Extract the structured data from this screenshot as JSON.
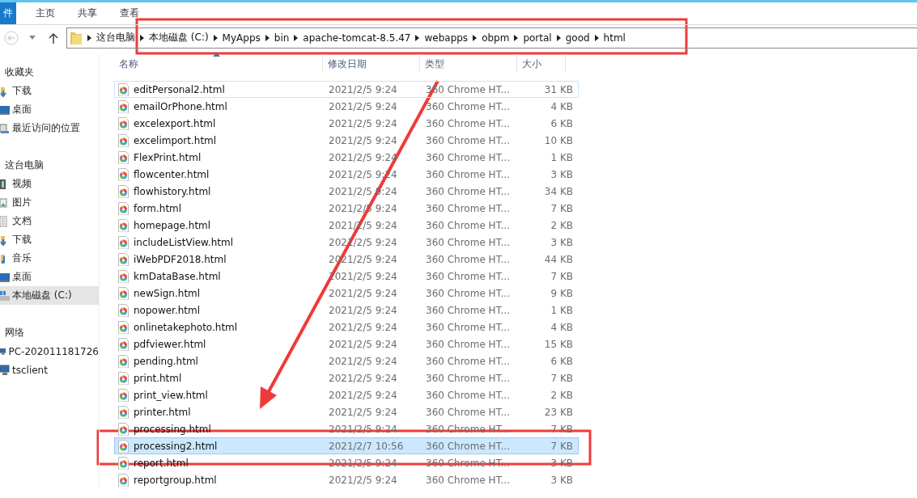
{
  "ribbon": {
    "tabs": [
      {
        "label": "件",
        "kind": "file"
      },
      {
        "label": "主页",
        "kind": "tab"
      },
      {
        "label": "共享",
        "kind": "tab"
      },
      {
        "label": "查看",
        "kind": "tab"
      }
    ]
  },
  "address": {
    "crumbs": [
      "这台电脑",
      "本地磁盘 (C:)",
      "MyApps",
      "bin",
      "apache-tomcat-8.5.47",
      "webapps",
      "obpm",
      "portal",
      "good",
      "html"
    ]
  },
  "sidebar": {
    "items": [
      {
        "label": "收藏夹",
        "kind": "heading",
        "selected": false
      },
      {
        "label": "下载",
        "kind": "download",
        "selected": false
      },
      {
        "label": "桌面",
        "kind": "desktop",
        "selected": false
      },
      {
        "label": "最近访问的位置",
        "kind": "recent",
        "selected": false
      },
      {
        "label": "这台电脑",
        "kind": "heading",
        "selected": false
      },
      {
        "label": "视频",
        "kind": "video",
        "selected": false
      },
      {
        "label": "图片",
        "kind": "pictures",
        "selected": false
      },
      {
        "label": "文档",
        "kind": "documents",
        "selected": false
      },
      {
        "label": "下载",
        "kind": "download",
        "selected": false
      },
      {
        "label": "音乐",
        "kind": "music",
        "selected": false
      },
      {
        "label": "桌面",
        "kind": "desktop",
        "selected": false
      },
      {
        "label": "本地磁盘 (C:)",
        "kind": "drive",
        "selected": true
      },
      {
        "label": "网络",
        "kind": "heading",
        "selected": false
      },
      {
        "label": "PC-202011181726",
        "kind": "computer",
        "selected": false
      },
      {
        "label": "tsclient",
        "kind": "computer",
        "selected": false
      }
    ]
  },
  "table": {
    "columns": [
      "名称",
      "修改日期",
      "类型",
      "大小"
    ],
    "rows": [
      {
        "name": "editPersonal2.html",
        "modified": "2021/2/5 9:24",
        "type": "360 Chrome HT...",
        "size": "31 KB",
        "selected": false,
        "hover": true
      },
      {
        "name": "emailOrPhone.html",
        "modified": "2021/2/5 9:24",
        "type": "360 Chrome HT...",
        "size": "4 KB",
        "selected": false,
        "hover": false
      },
      {
        "name": "excelexport.html",
        "modified": "2021/2/5 9:24",
        "type": "360 Chrome HT...",
        "size": "6 KB",
        "selected": false,
        "hover": false
      },
      {
        "name": "excelimport.html",
        "modified": "2021/2/5 9:24",
        "type": "360 Chrome HT...",
        "size": "10 KB",
        "selected": false,
        "hover": false
      },
      {
        "name": "FlexPrint.html",
        "modified": "2021/2/5 9:24",
        "type": "360 Chrome HT...",
        "size": "1 KB",
        "selected": false,
        "hover": false
      },
      {
        "name": "flowcenter.html",
        "modified": "2021/2/5 9:24",
        "type": "360 Chrome HT...",
        "size": "3 KB",
        "selected": false,
        "hover": false
      },
      {
        "name": "flowhistory.html",
        "modified": "2021/2/5 9:24",
        "type": "360 Chrome HT...",
        "size": "34 KB",
        "selected": false,
        "hover": false
      },
      {
        "name": "form.html",
        "modified": "2021/2/5 9:24",
        "type": "360 Chrome HT...",
        "size": "7 KB",
        "selected": false,
        "hover": false
      },
      {
        "name": "homepage.html",
        "modified": "2021/2/5 9:24",
        "type": "360 Chrome HT...",
        "size": "2 KB",
        "selected": false,
        "hover": false
      },
      {
        "name": "includeListView.html",
        "modified": "2021/2/5 9:24",
        "type": "360 Chrome HT...",
        "size": "3 KB",
        "selected": false,
        "hover": false
      },
      {
        "name": "iWebPDF2018.html",
        "modified": "2021/2/5 9:24",
        "type": "360 Chrome HT...",
        "size": "44 KB",
        "selected": false,
        "hover": false
      },
      {
        "name": "kmDataBase.html",
        "modified": "2021/2/5 9:24",
        "type": "360 Chrome HT...",
        "size": "7 KB",
        "selected": false,
        "hover": false
      },
      {
        "name": "newSign.html",
        "modified": "2021/2/5 9:24",
        "type": "360 Chrome HT...",
        "size": "9 KB",
        "selected": false,
        "hover": false
      },
      {
        "name": "nopower.html",
        "modified": "2021/2/5 9:24",
        "type": "360 Chrome HT...",
        "size": "1 KB",
        "selected": false,
        "hover": false
      },
      {
        "name": "onlinetakephoto.html",
        "modified": "2021/2/5 9:24",
        "type": "360 Chrome HT...",
        "size": "4 KB",
        "selected": false,
        "hover": false
      },
      {
        "name": "pdfviewer.html",
        "modified": "2021/2/5 9:24",
        "type": "360 Chrome HT...",
        "size": "15 KB",
        "selected": false,
        "hover": false
      },
      {
        "name": "pending.html",
        "modified": "2021/2/5 9:24",
        "type": "360 Chrome HT...",
        "size": "6 KB",
        "selected": false,
        "hover": false
      },
      {
        "name": "print.html",
        "modified": "2021/2/5 9:24",
        "type": "360 Chrome HT...",
        "size": "7 KB",
        "selected": false,
        "hover": false
      },
      {
        "name": "print_view.html",
        "modified": "2021/2/5 9:24",
        "type": "360 Chrome HT...",
        "size": "2 KB",
        "selected": false,
        "hover": false
      },
      {
        "name": "printer.html",
        "modified": "2021/2/5 9:24",
        "type": "360 Chrome HT...",
        "size": "23 KB",
        "selected": false,
        "hover": false
      },
      {
        "name": "processing.html",
        "modified": "2021/2/5 9:24",
        "type": "360 Chrome HT...",
        "size": "7 KB",
        "selected": false,
        "hover": false
      },
      {
        "name": "processing2.html",
        "modified": "2021/2/7 10:56",
        "type": "360 Chrome HT...",
        "size": "7 KB",
        "selected": true,
        "hover": false
      },
      {
        "name": "report.html",
        "modified": "2021/2/5 9:24",
        "type": "360 Chrome HT...",
        "size": "3 KB",
        "selected": false,
        "hover": false
      },
      {
        "name": "reportgroup.html",
        "modified": "2021/2/5 9:24",
        "type": "360 Chrome HT...",
        "size": "3 KB",
        "selected": false,
        "hover": false
      }
    ]
  }
}
